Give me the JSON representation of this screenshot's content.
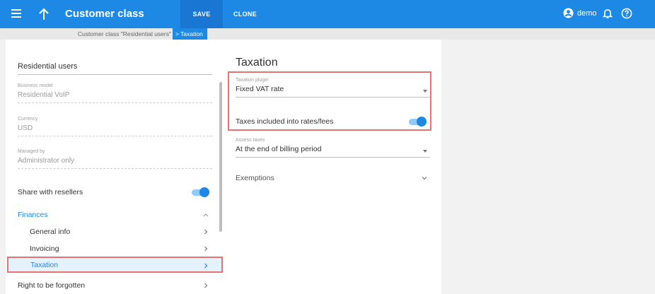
{
  "header": {
    "title": "Customer class",
    "save_label": "SAVE",
    "clone_label": "CLONE",
    "user_name": "demo"
  },
  "breadcrumb": {
    "parent": "Customer class \"Residential users\"",
    "current": "> Taxation"
  },
  "left": {
    "name": "Residential users",
    "fields": [
      {
        "label": "Business model",
        "value": "Residential VoIP"
      },
      {
        "label": "Currency",
        "value": "USD"
      },
      {
        "label": "Managed by",
        "value": "Administrator only"
      }
    ],
    "share_label": "Share with resellers",
    "share_on": true,
    "nav": {
      "finances": "Finances",
      "general_info": "General info",
      "invoicing": "Invoicing",
      "taxation": "Taxation",
      "right_to_be_forgotten": "Right to be forgotten"
    }
  },
  "main": {
    "title": "Taxation",
    "taxation_plugin": {
      "label": "Taxation plugin",
      "value": "Fixed VAT rate"
    },
    "taxes_included": {
      "label": "Taxes included into rates/fees",
      "on": true
    },
    "assess_taxes": {
      "label": "Assess taxes",
      "value": "At the end of billing period"
    },
    "exemptions": "Exemptions"
  },
  "colors": {
    "accent": "#1e88e5",
    "highlight_border": "#e57373"
  },
  "icons": [
    "menu-icon",
    "arrow-up-icon",
    "user-icon",
    "bell-icon",
    "help-icon",
    "chevron-right-icon",
    "chevron-up-icon",
    "chevron-down-icon",
    "caret-down-icon"
  ]
}
